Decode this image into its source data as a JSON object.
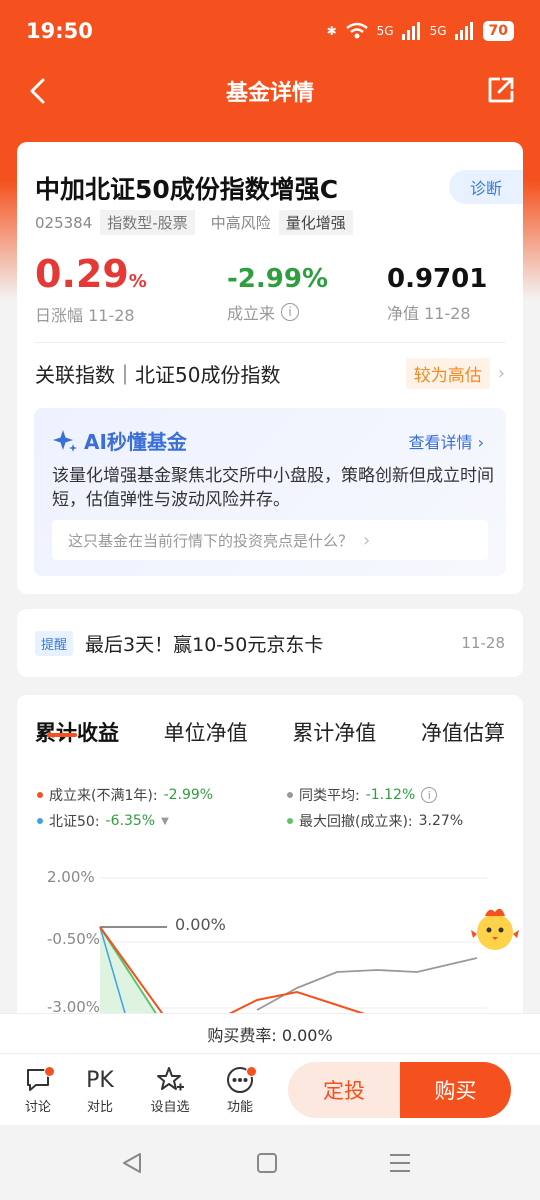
{
  "status": {
    "time": "19:50",
    "battery": "70",
    "signal1": "5G",
    "signal2": "5G"
  },
  "nav": {
    "title": "基金详情"
  },
  "fund": {
    "name": "中加北证50成份指数增强C",
    "code": "025384",
    "tag1": "指数型-股票",
    "risk": "中高风险",
    "tag2": "量化增强",
    "diag": "诊断",
    "daily_change": "0.29",
    "daily_change_unit": "%",
    "daily_label": "日涨幅 11-28",
    "since_inception": "-2.99%",
    "since_label": "成立来",
    "nav_value": "0.9701",
    "nav_label": "净值 11-28",
    "related_index": "关联指数｜北证50成份指数",
    "valuation": "较为高估"
  },
  "ai": {
    "title": "AI秒懂基金",
    "more": "查看详情",
    "text": "该量化增强基金聚焦北交所中小盘股，策略创新但成立时间短，估值弹性与波动风险并存。",
    "question": "这只基金在当前行情下的投资亮点是什么？"
  },
  "reminder": {
    "tag": "提醒",
    "text": "最后3天！赢10-50元京东卡",
    "date": "11-28"
  },
  "chart_tabs": [
    "累计收益",
    "单位净值",
    "累计净值",
    "净值估算"
  ],
  "legend": {
    "l1_label": "成立来(不满1年):",
    "l1_value": "-2.99%",
    "l2_label": "同类平均:",
    "l2_value": "-1.12%",
    "l3_label": "北证50:",
    "l3_value": "-6.35%",
    "l4_label": "最大回撤(成立来):",
    "l4_value": "3.27%"
  },
  "chart_labels": {
    "y1": "2.00%",
    "y2": "-0.50%",
    "y3": "-3.00%",
    "marker": "0.00%"
  },
  "colors": {
    "accent": "#f4511e",
    "up": "#e53935",
    "down": "#2e9e3e",
    "blue": "#3a7bd5"
  },
  "fee": "购买费率: 0.00%",
  "bottom": {
    "discuss": "讨论",
    "pk_icon": "PK",
    "compare": "对比",
    "watch": "设自选",
    "func": "功能",
    "sip": "定投",
    "buy": "购买"
  }
}
